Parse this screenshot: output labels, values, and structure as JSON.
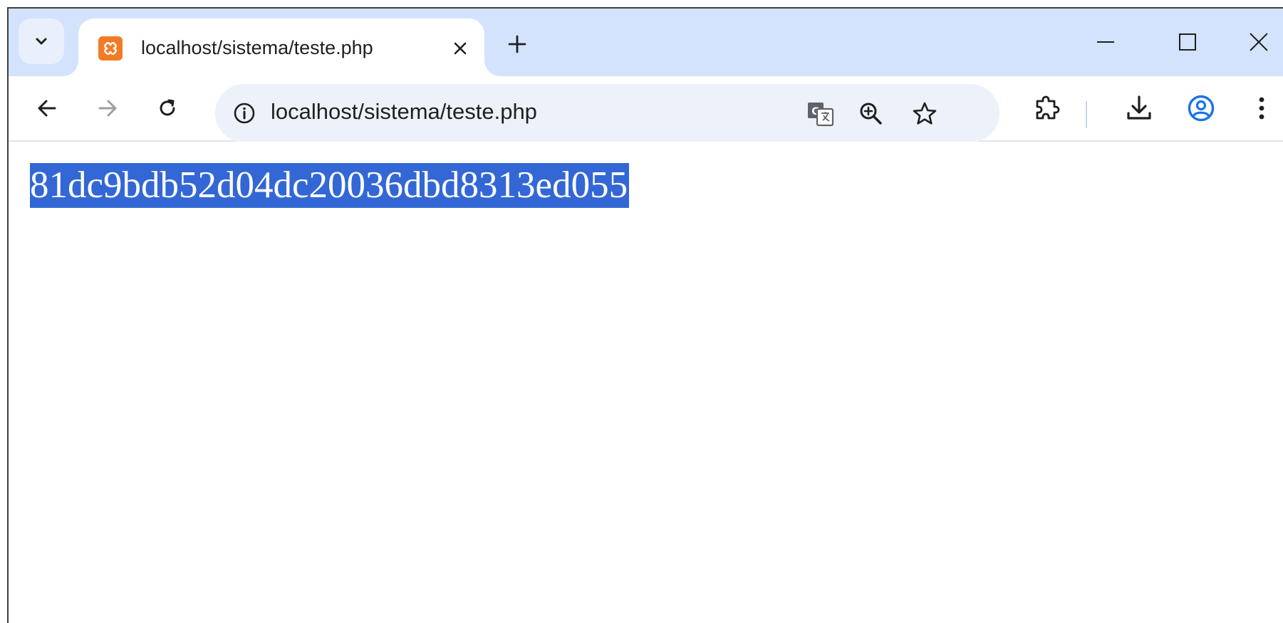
{
  "tab": {
    "title": "localhost/sistema/teste.php",
    "favicon": "xampp-icon"
  },
  "omnibox": {
    "url": "localhost/sistema/teste.php"
  },
  "page": {
    "text": "81dc9bdb52d04dc20036dbd8313ed055",
    "text_selected": true
  },
  "icons": {
    "tab_search": "chevron-down-icon",
    "tab_close": "close-icon",
    "new_tab": "plus-icon",
    "back": "arrow-left-icon",
    "forward": "arrow-right-icon",
    "reload": "reload-icon",
    "site_info": "info-icon",
    "translate": "translate-icon",
    "zoom": "zoom-in-icon",
    "bookmark": "star-icon",
    "extensions": "puzzle-icon",
    "downloads": "download-icon",
    "profile": "profile-icon",
    "menu": "kebab-menu-icon"
  },
  "colors": {
    "tabstrip": "#d3e3fd",
    "omnibox": "#edf2fa",
    "selection": "#3367d6",
    "favicon": "#f27b26",
    "profile": "#1a73e8"
  }
}
